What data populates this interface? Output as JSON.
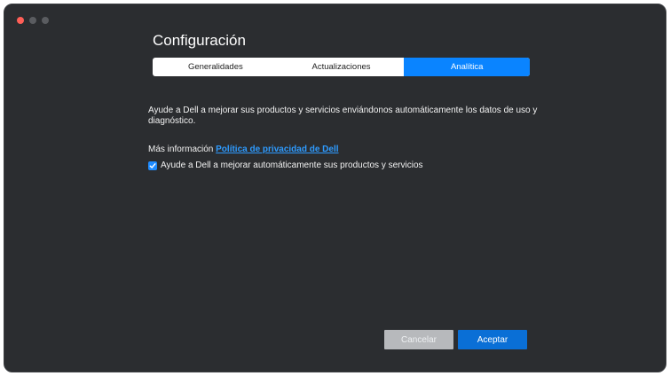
{
  "window": {
    "title": "Configuración"
  },
  "tabs": [
    {
      "label": "Generalidades",
      "active": false
    },
    {
      "label": "Actualizaciones",
      "active": false
    },
    {
      "label": "Analítica",
      "active": true
    }
  ],
  "content": {
    "description": "Ayude a Dell a mejorar sus productos y servicios enviándonos automáticamente los datos de uso y diagnóstico.",
    "more_info_label": "Más información",
    "privacy_link": "Política de privacidad de Dell",
    "checkbox_label": "Ayude a Dell a mejorar automáticamente sus productos y servicios",
    "checkbox_checked": true
  },
  "buttons": {
    "cancel": "Cancelar",
    "accept": "Aceptar"
  },
  "colors": {
    "accent": "#0a84ff",
    "link": "#2e9bff",
    "background": "#2b2d30",
    "cancel_disabled": "#b7b9bc"
  }
}
